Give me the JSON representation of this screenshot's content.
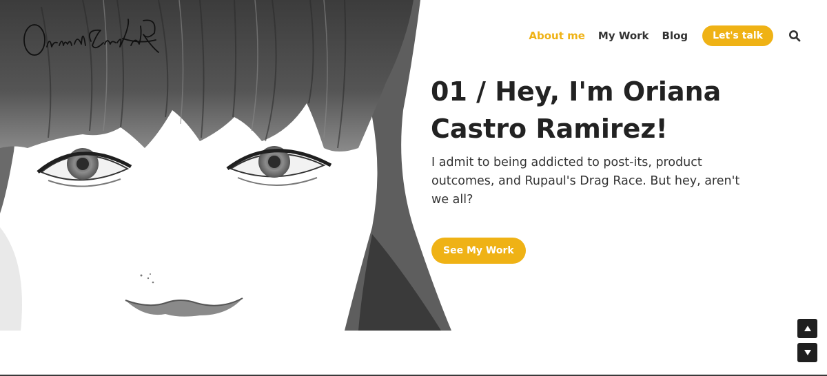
{
  "header": {
    "logo_signature": "Oriana Castro",
    "nav": [
      {
        "label": "About me",
        "active": true
      },
      {
        "label": "My Work",
        "active": false
      },
      {
        "label": "Blog",
        "active": false
      }
    ],
    "cta_label": "Let's talk",
    "search_icon": "search-icon"
  },
  "hero": {
    "title": "01 / Hey, I'm Oriana Castro Ramirez!",
    "text": "I admit to being addicted to post-its, product outcomes, and Rupaul's Drag Race. But hey, aren't we all?",
    "button_label": "See My Work"
  },
  "scroll": {
    "up_icon": "triangle-up-icon",
    "down_icon": "triangle-down-icon"
  },
  "colors": {
    "accent": "#efb215",
    "text": "#222222",
    "dark": "#1f1f1f"
  }
}
